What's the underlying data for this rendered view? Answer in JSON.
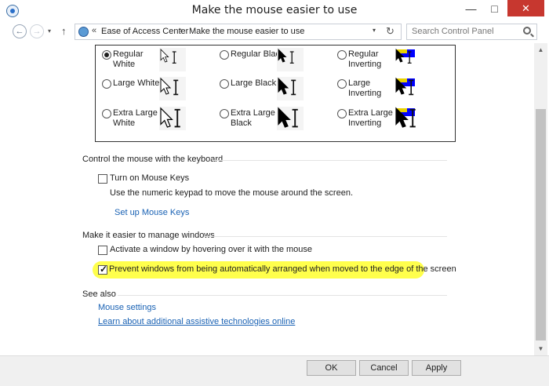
{
  "window": {
    "title": "Make the mouse easier to use",
    "min_glyph": "—",
    "max_glyph": "□",
    "close_glyph": "✕"
  },
  "nav": {
    "back_glyph": "←",
    "forward_glyph": "→",
    "dropdown_glyph": "▾",
    "up_glyph": "↑"
  },
  "address": {
    "separator": "«",
    "crumb_arrow": "›",
    "breadcrumbs": [
      "Ease of Access Center",
      "Make the mouse easier to use"
    ],
    "dropdown_glyph": "▾",
    "refresh_glyph": "↻"
  },
  "search": {
    "placeholder": "Search Control Panel"
  },
  "pointers": {
    "options": [
      {
        "line1": "Regular",
        "line2": "White",
        "checked": true,
        "style": "white",
        "size": "regular"
      },
      {
        "line1": "Regular Black",
        "line2": "",
        "checked": false,
        "style": "black",
        "size": "regular"
      },
      {
        "line1": "Regular",
        "line2": "Inverting",
        "checked": false,
        "style": "inverting",
        "size": "regular"
      },
      {
        "line1": "Large White",
        "line2": "",
        "checked": false,
        "style": "white",
        "size": "large"
      },
      {
        "line1": "Large Black",
        "line2": "",
        "checked": false,
        "style": "black",
        "size": "large"
      },
      {
        "line1": "Large",
        "line2": "Inverting",
        "checked": false,
        "style": "inverting",
        "size": "large"
      },
      {
        "line1": "Extra Large",
        "line2": "White",
        "checked": false,
        "style": "white",
        "size": "xlarge"
      },
      {
        "line1": "Extra Large",
        "line2": "Black",
        "checked": false,
        "style": "black",
        "size": "xlarge"
      },
      {
        "line1": "Extra Large",
        "line2": "Inverting",
        "checked": false,
        "style": "inverting",
        "size": "xlarge"
      }
    ]
  },
  "keyboard": {
    "heading": "Control the mouse with the keyboard",
    "mouse_keys_label": "Turn on Mouse Keys",
    "mouse_keys_checked": false,
    "description": "Use the numeric keypad to move the mouse around the screen.",
    "setup_link": "Set up Mouse Keys"
  },
  "windows": {
    "heading": "Make it easier to manage windows",
    "hover_label": "Activate a window by hovering over it with the mouse",
    "hover_checked": false,
    "snap_label": "Prevent windows from being automatically arranged when moved to the edge of the screen",
    "snap_checked": true
  },
  "see_also": {
    "heading": "See also",
    "links": [
      "Mouse settings",
      "Learn about additional assistive technologies online"
    ]
  },
  "footer": {
    "ok": "OK",
    "cancel": "Cancel",
    "apply": "Apply"
  },
  "scrollbar": {
    "up_glyph": "▲",
    "down_glyph": "▼"
  },
  "colors": {
    "highlight": "#ffff4c",
    "link": "#1a62b4",
    "close_button": "#c7372f",
    "inverting_preview": "#0000ff"
  }
}
